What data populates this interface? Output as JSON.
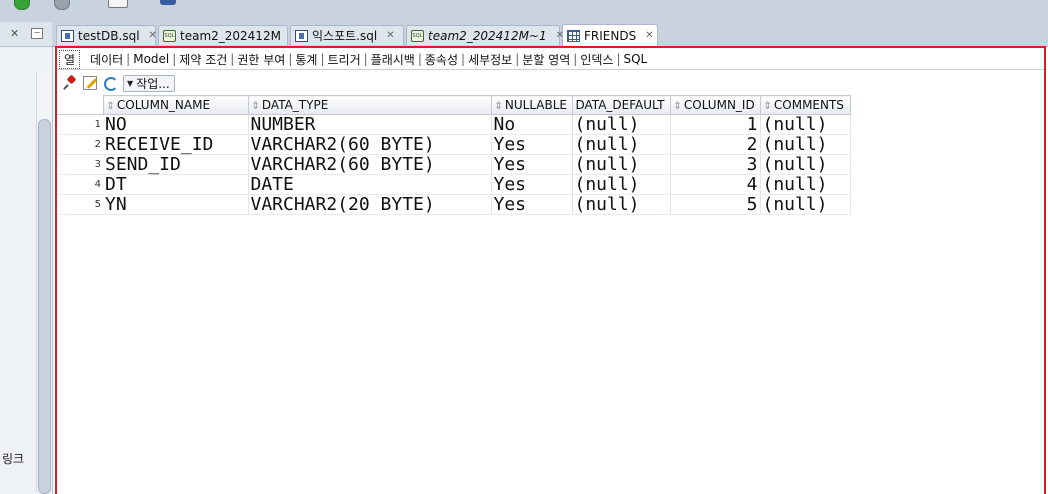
{
  "sidebar": {
    "bottom_label": "링크"
  },
  "tabs": [
    {
      "label": "testDB.sql",
      "icon": "sql-file-icon",
      "italic": false,
      "active": false
    },
    {
      "label": "team2_202412M",
      "icon": "sql-connection-icon",
      "italic": false,
      "active": false
    },
    {
      "label": "익스포트.sql",
      "icon": "sql-file-icon",
      "italic": false,
      "active": false
    },
    {
      "label": "team2_202412M~1",
      "icon": "sql-connection-icon",
      "italic": true,
      "active": false
    },
    {
      "label": "FRIENDS",
      "icon": "table-icon",
      "italic": false,
      "active": true
    }
  ],
  "subtabs": [
    "열",
    "데이터",
    "Model",
    "제약 조건",
    "권한 부여",
    "통계",
    "트리거",
    "플래시백",
    "종속성",
    "세부정보",
    "분할 영역",
    "인덱스",
    "SQL"
  ],
  "toolbar": {
    "action_label": "작업..."
  },
  "table": {
    "columns": [
      "COLUMN_NAME",
      "DATA_TYPE",
      "NULLABLE",
      "DATA_DEFAULT",
      "COLUMN_ID",
      "COMMENTS"
    ],
    "rows": [
      {
        "num": "1",
        "name": "NO",
        "type": "NUMBER",
        "nullable": "No",
        "default": "(null)",
        "id": "1",
        "comments": "(null)"
      },
      {
        "num": "2",
        "name": "RECEIVE_ID",
        "type": "VARCHAR2(60 BYTE)",
        "nullable": "Yes",
        "default": "(null)",
        "id": "2",
        "comments": "(null)"
      },
      {
        "num": "3",
        "name": "SEND_ID",
        "type": "VARCHAR2(60 BYTE)",
        "nullable": "Yes",
        "default": "(null)",
        "id": "3",
        "comments": "(null)"
      },
      {
        "num": "4",
        "name": "DT",
        "type": "DATE",
        "nullable": "Yes",
        "default": "(null)",
        "id": "4",
        "comments": "(null)"
      },
      {
        "num": "5",
        "name": "YN",
        "type": "VARCHAR2(20 BYTE)",
        "nullable": "Yes",
        "default": "(null)",
        "id": "5",
        "comments": "(null)"
      }
    ]
  },
  "colors": {
    "active_border": "#d0212a",
    "header_bg": "#c9d3e0"
  }
}
